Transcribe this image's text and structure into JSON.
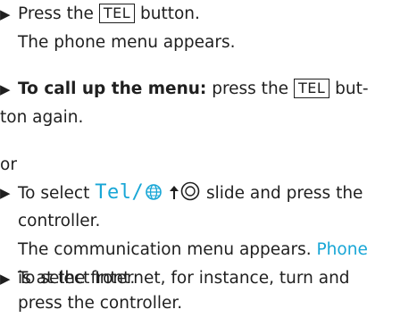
{
  "steps": [
    {
      "l1_pre": "Press the",
      "key": "TEL",
      "l1_post": "button.",
      "l2": "The phone menu appears."
    },
    {
      "bold": "To call up the menu:",
      "l1_mid": "press the",
      "key": "TEL",
      "l1_post": "but-",
      "l2": "ton again."
    },
    {
      "l1_pre": "To select",
      "disp": "Tel/",
      "l1_post": "slide and press the",
      "l2": "controller.",
      "l3": "The communication menu appears.",
      "l3_accent": "Phone",
      "l4": "is at the front."
    },
    {
      "l1": "To select Internet, for instance, turn and",
      "l2": "press the controller."
    }
  ],
  "or_text": "or",
  "icons": [
    "bullet-arrow-icon",
    "globe-icon",
    "slide-up-arrow-icon",
    "controller-icon"
  ],
  "colors": {
    "accent": "#18a6d6",
    "text": "#1f1f1f"
  }
}
